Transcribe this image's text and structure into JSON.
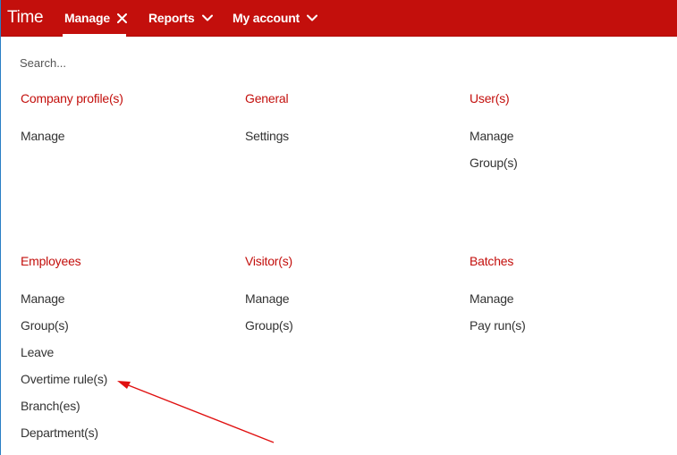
{
  "topbar": {
    "brand": "Time",
    "nav": {
      "manage": "Manage",
      "reports": "Reports",
      "my_account": "My account"
    }
  },
  "search": {
    "placeholder": "Search..."
  },
  "sections": {
    "company_profiles": {
      "title": "Company profile(s)",
      "items": [
        "Manage"
      ]
    },
    "general": {
      "title": "General",
      "items": [
        "Settings"
      ]
    },
    "users": {
      "title": "User(s)",
      "items": [
        "Manage",
        "Group(s)"
      ]
    },
    "employees": {
      "title": "Employees",
      "items": [
        "Manage",
        "Group(s)",
        "Leave",
        "Overtime rule(s)",
        "Branch(es)",
        "Department(s)"
      ]
    },
    "visitors": {
      "title": "Visitor(s)",
      "items": [
        "Manage",
        "Group(s)"
      ]
    },
    "batches": {
      "title": "Batches",
      "items": [
        "Manage",
        "Pay run(s)"
      ]
    }
  },
  "colors": {
    "accent": "#c30f0c",
    "text": "#333333",
    "annotation_arrow": "#e01010"
  },
  "icons": {
    "manage_close": "close-icon",
    "reports_chevron": "chevron-down-icon",
    "account_chevron": "chevron-down-icon"
  }
}
